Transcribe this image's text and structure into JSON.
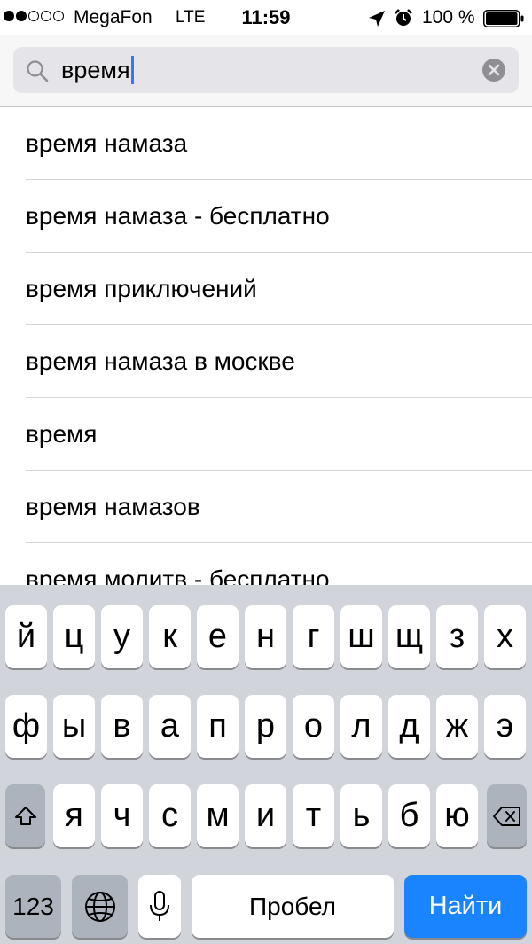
{
  "status_bar": {
    "carrier": "MegaFon",
    "network": "LTE",
    "time": "11:59",
    "battery": "100 %",
    "signal_bars_filled": 2,
    "signal_bars_total": 5
  },
  "search": {
    "query": "время"
  },
  "suggestions": [
    "время намаза",
    "время намаза - бесплатно",
    "время приключений",
    "время намаза в москве",
    "время",
    "время намазов",
    "время молитв - бесплатно"
  ],
  "keyboard": {
    "row1": [
      "й",
      "ц",
      "у",
      "к",
      "е",
      "н",
      "г",
      "ш",
      "щ",
      "з",
      "х"
    ],
    "row2": [
      "ф",
      "ы",
      "в",
      "а",
      "п",
      "р",
      "о",
      "л",
      "д",
      "ж",
      "э"
    ],
    "row3": [
      "я",
      "ч",
      "с",
      "м",
      "и",
      "т",
      "ь",
      "б",
      "ю"
    ],
    "numbers_label": "123",
    "space_label": "Пробел",
    "go_label": "Найти"
  },
  "colors": {
    "accent": "#1a84ff",
    "caret": "#3478f6",
    "keyboard_bg": "#d1d5db",
    "dark_key": "#adb3bc"
  },
  "icons": {
    "shift": "shift-icon",
    "delete": "backspace-icon",
    "globe": "globe-icon",
    "mic": "microphone-icon"
  }
}
